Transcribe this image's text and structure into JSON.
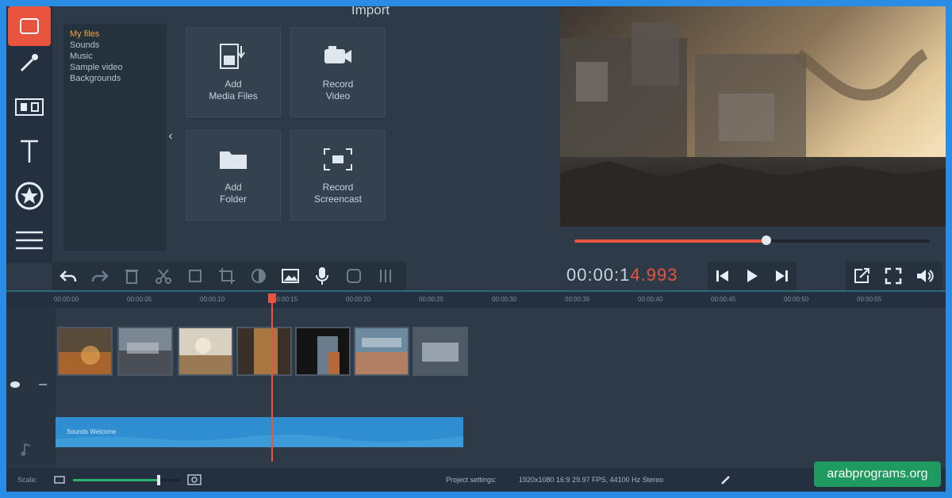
{
  "window": {
    "title": "Import"
  },
  "tools": [
    {
      "name": "import-tool",
      "active": true
    },
    {
      "name": "filters-tool",
      "active": false
    },
    {
      "name": "transitions-tool",
      "active": false
    },
    {
      "name": "titles-tool",
      "active": false
    },
    {
      "name": "stickers-tool",
      "active": false
    },
    {
      "name": "more-tool",
      "active": false
    }
  ],
  "library": {
    "items": [
      "My files",
      "Sounds",
      "Music",
      "Sample video",
      "Backgrounds"
    ],
    "selected_index": 0
  },
  "import_tiles": [
    {
      "label": "Add\nMedia Files",
      "icon": "add-media-icon"
    },
    {
      "label": "Record\nVideo",
      "icon": "camera-icon"
    },
    {
      "label": "Add\nFolder",
      "icon": "folder-icon"
    },
    {
      "label": "Record\nScreencast",
      "icon": "screencast-icon"
    }
  ],
  "preview": {
    "timecode_main": "00:00:1",
    "timecode_ms": "4.993",
    "progress": 0.54
  },
  "ruler": {
    "ticks": [
      "00:00:00",
      "00:00:05",
      "00:00:10",
      "00:00:15",
      "00:00:20",
      "00:00:25",
      "00:00:30",
      "00:00:35",
      "00:00:40",
      "00:00:45",
      "00:00:50",
      "00:00:55"
    ]
  },
  "timeline": {
    "audio_label": "Sounds Welcome"
  },
  "status": {
    "scale_label": "Scale:",
    "zoom": 0.78,
    "settings_label": "Project settings:",
    "settings_value": "1920x1080 16:9 29.97 FPS, 44100 Hz Stereo"
  },
  "watermark": "arabprograms.org",
  "colors": {
    "accent": "#e8543e",
    "audio": "#2e8ecf",
    "zoom": "#27b36d"
  }
}
